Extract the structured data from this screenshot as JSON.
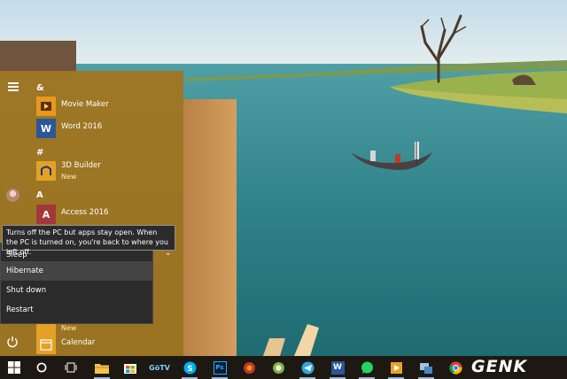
{
  "start_menu": {
    "groups": [
      {
        "header": "&",
        "apps": [
          {
            "name": "Movie Maker",
            "icon": "movie-maker-icon",
            "tile_color": "#e8971f"
          },
          {
            "name": "Word 2016",
            "icon": "word-icon",
            "tile_color": "#2b5797"
          }
        ]
      },
      {
        "header": "#",
        "apps": [
          {
            "name": "3D Builder",
            "subtitle": "New",
            "icon": "3d-builder-icon",
            "tile_color": "#e4a126"
          }
        ]
      },
      {
        "header": "A",
        "apps": [
          {
            "name": "Access 2016",
            "icon": "access-icon",
            "tile_color": "#a4373a"
          }
        ]
      },
      {
        "header": "",
        "apps": [
          {
            "name": "",
            "subtitle": "New",
            "icon": "partial-app-icon",
            "tile_color": "#e4a126"
          },
          {
            "name": "Calendar",
            "icon": "calendar-icon",
            "tile_color": "#e4a126"
          }
        ]
      }
    ],
    "tooltip": "Turns off the PC but apps stay open. When the PC is turned on, you're back to where you left off.",
    "power_menu": {
      "items": [
        "Sleep",
        "Hibernate",
        "Shut down",
        "Restart"
      ],
      "highlighted": "Hibernate"
    }
  },
  "taskbar": {
    "items": [
      {
        "name": "start-button",
        "icon": "windows-logo-icon"
      },
      {
        "name": "cortana-button",
        "icon": "cortana-circle-icon"
      },
      {
        "name": "task-view-button",
        "icon": "task-view-icon"
      },
      {
        "name": "file-explorer",
        "icon": "folder-icon"
      },
      {
        "name": "store",
        "icon": "store-icon"
      },
      {
        "name": "gotiengviet",
        "icon": "gotv-icon",
        "label": "GõTV"
      },
      {
        "name": "skype",
        "icon": "skype-icon"
      },
      {
        "name": "photoshop",
        "icon": "photoshop-icon",
        "label": "Ps"
      },
      {
        "name": "app-red",
        "icon": "red-app-icon"
      },
      {
        "name": "app-color",
        "icon": "color-app-icon"
      },
      {
        "name": "telegram",
        "icon": "telegram-icon"
      },
      {
        "name": "word",
        "icon": "word-icon",
        "label": "W"
      },
      {
        "name": "whatsapp",
        "icon": "whatsapp-icon"
      },
      {
        "name": "media-player",
        "icon": "media-icon"
      },
      {
        "name": "network-app",
        "icon": "network-icon"
      },
      {
        "name": "chrome",
        "icon": "chrome-icon"
      }
    ],
    "watermark": "GENK"
  },
  "colors": {
    "menu_bg": "#a4741c",
    "taskbar_bg": "#1d1912",
    "power_menu_bg": "#2b2b2b",
    "highlight": "#444444"
  }
}
